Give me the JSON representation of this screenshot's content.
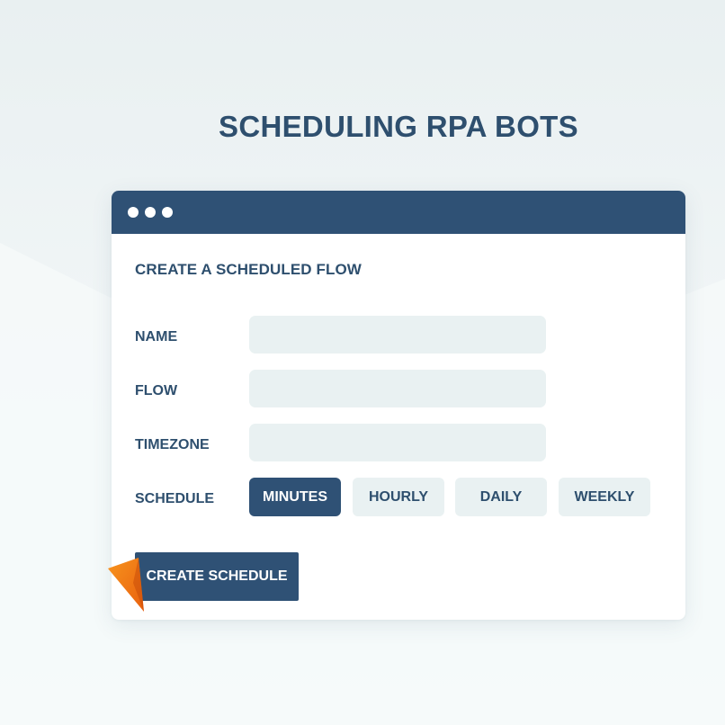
{
  "page": {
    "title": "SCHEDULING RPA BOTS"
  },
  "window": {
    "controls": [
      "dot",
      "dot",
      "dot"
    ]
  },
  "form": {
    "heading": "CREATE A SCHEDULED FLOW",
    "fields": [
      {
        "label": "NAME",
        "value": ""
      },
      {
        "label": "FLOW",
        "value": ""
      },
      {
        "label": "TIMEZONE",
        "value": ""
      }
    ],
    "schedule": {
      "label": "SCHEDULE",
      "options": [
        "MINUTES",
        "HOURLY",
        "DAILY",
        "WEEKLY"
      ],
      "selected": "MINUTES"
    },
    "submit_label": "CREATE SCHEDULE"
  },
  "colors": {
    "primary": "#2f5175",
    "text": "#2e4f6e",
    "field_bg": "#e9f1f2",
    "cursor": "#f07a16"
  },
  "icons": {
    "cursor": "cursor-arrow-icon"
  }
}
